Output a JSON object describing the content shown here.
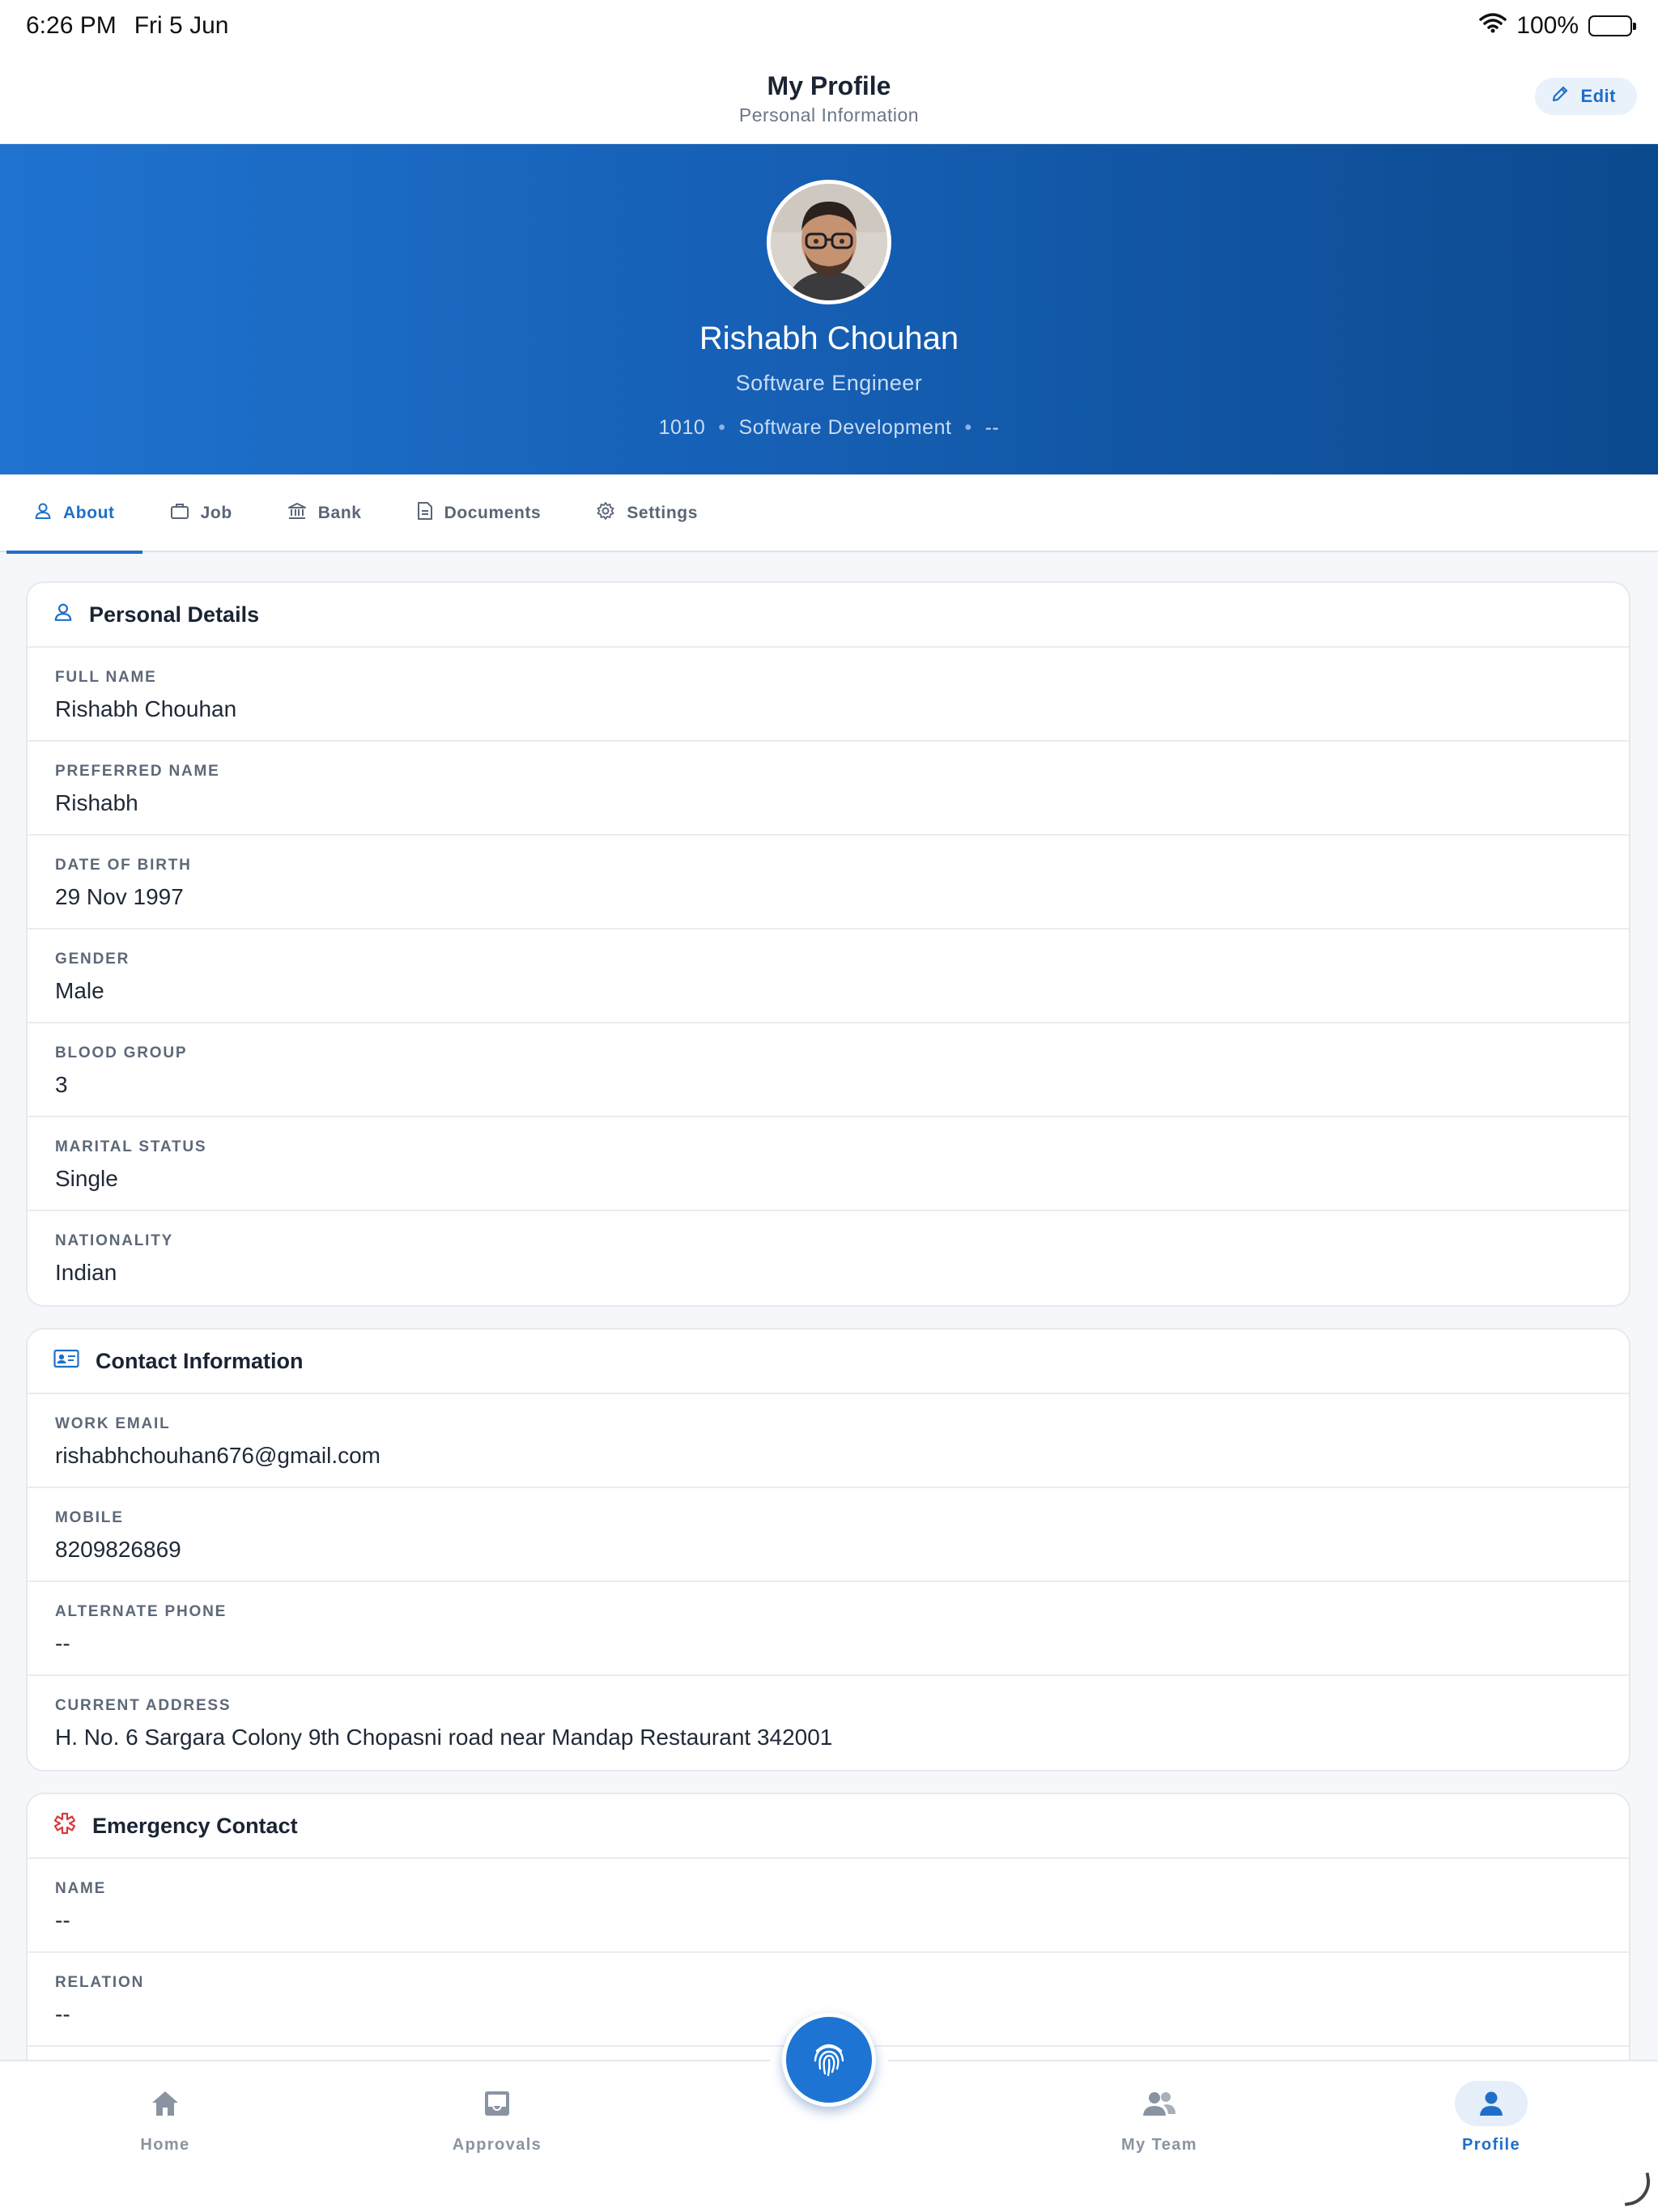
{
  "status_bar": {
    "time": "6:26 PM",
    "date": "Fri 5 Jun",
    "battery": "100%"
  },
  "header": {
    "title": "My Profile",
    "subtitle": "Personal Information",
    "edit_label": "Edit"
  },
  "profile": {
    "name": "Rishabh Chouhan",
    "role": "Software Engineer",
    "employee_id": "1010",
    "department": "Software Development",
    "location": "--"
  },
  "tabs": [
    {
      "label": "About",
      "icon": "person-icon",
      "active": true
    },
    {
      "label": "Job",
      "icon": "briefcase-icon"
    },
    {
      "label": "Bank",
      "icon": "bank-icon"
    },
    {
      "label": "Documents",
      "icon": "document-icon"
    },
    {
      "label": "Settings",
      "icon": "gear-icon"
    }
  ],
  "personal": {
    "title": "Personal Details",
    "fields": [
      {
        "label": "FULL NAME",
        "value": "Rishabh Chouhan"
      },
      {
        "label": "PREFERRED NAME",
        "value": "Rishabh"
      },
      {
        "label": "DATE OF BIRTH",
        "value": "29 Nov 1997"
      },
      {
        "label": "GENDER",
        "value": "Male"
      },
      {
        "label": "BLOOD GROUP",
        "value": "3"
      },
      {
        "label": "MARITAL STATUS",
        "value": "Single"
      },
      {
        "label": "NATIONALITY",
        "value": "Indian"
      }
    ]
  },
  "contact": {
    "title": "Contact Information",
    "fields": [
      {
        "label": "WORK EMAIL",
        "value": "rishabhchouhan676@gmail.com"
      },
      {
        "label": "MOBILE",
        "value": "8209826869"
      },
      {
        "label": "ALTERNATE PHONE",
        "value": "--"
      },
      {
        "label": "CURRENT ADDRESS",
        "value": "H. No. 6 Sargara Colony 9th Chopasni road near Mandap Restaurant  342001"
      }
    ]
  },
  "emergency": {
    "title": "Emergency Contact",
    "fields": [
      {
        "label": "NAME",
        "value": "--"
      },
      {
        "label": "RELATION",
        "value": "--"
      }
    ]
  },
  "bottom_nav": [
    {
      "label": "Home",
      "icon": "home-icon"
    },
    {
      "label": "Approvals",
      "icon": "inbox-icon"
    },
    {
      "label": "My Team",
      "icon": "team-icon"
    },
    {
      "label": "Profile",
      "icon": "profile-icon",
      "active": true
    }
  ],
  "colors": {
    "accent": "#1f6fc8",
    "hero_start": "#1f73cf",
    "hero_end": "#0c4a8f",
    "emergency": "#d93a3a"
  }
}
